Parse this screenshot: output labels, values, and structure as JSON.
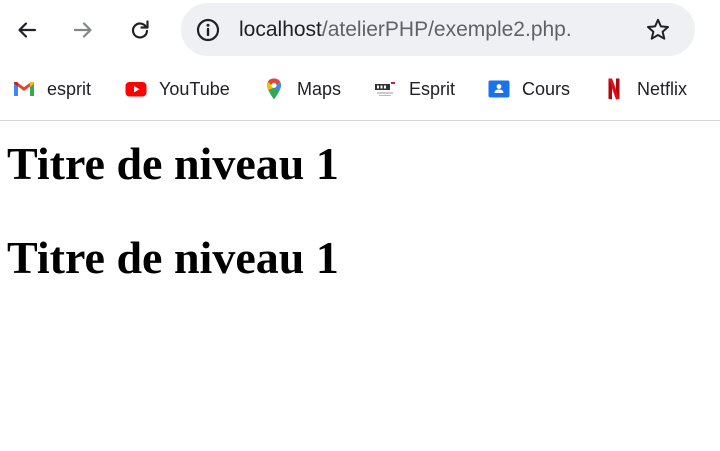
{
  "toolbar": {
    "url_host": "localhost",
    "url_path": "/atelierPHP/exemple2.php."
  },
  "bookmarks": [
    {
      "label": "esprit",
      "icon": "gmail-icon"
    },
    {
      "label": "YouTube",
      "icon": "youtube-icon"
    },
    {
      "label": "Maps",
      "icon": "maps-icon"
    },
    {
      "label": "Esprit",
      "icon": "esprit-logo-icon"
    },
    {
      "label": "Cours",
      "icon": "classroom-icon"
    },
    {
      "label": "Netflix",
      "icon": "netflix-icon"
    }
  ],
  "page": {
    "headings": [
      "Titre de niveau 1",
      "Titre de niveau 1"
    ]
  },
  "colors": {
    "omnibox_bg": "#eef0f3",
    "youtube_red": "#ff0000",
    "netflix_red": "#e50914",
    "classroom_blue": "#1a73e8"
  }
}
